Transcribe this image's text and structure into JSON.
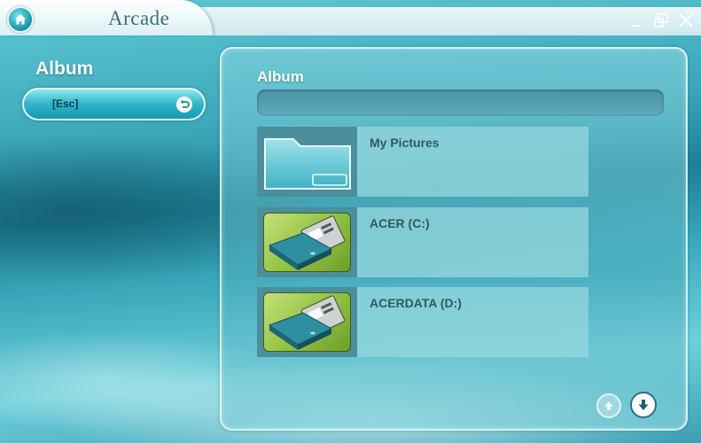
{
  "app": {
    "title": "Arcade",
    "icons": {
      "home": "home-icon",
      "minimize": "minimize-icon",
      "restore": "restore-icon",
      "close": "close-icon"
    }
  },
  "sidebar": {
    "heading": "Album",
    "esc_button": {
      "label": "[Esc]",
      "icon": "back-arrow-icon"
    }
  },
  "main": {
    "heading": "Album",
    "path_bar": "",
    "items": [
      {
        "label": "My Pictures",
        "icon": "folder-icon"
      },
      {
        "label": "ACER (C:)",
        "icon": "hard-drive-icon"
      },
      {
        "label": "ACERDATA (D:)",
        "icon": "hard-drive-icon"
      }
    ],
    "nav": {
      "up": "scroll-up-icon",
      "down": "scroll-down-icon"
    }
  },
  "colors": {
    "accent": "#1f9fb4",
    "panel": "#78cdd7",
    "text_dark": "#2f5960"
  }
}
